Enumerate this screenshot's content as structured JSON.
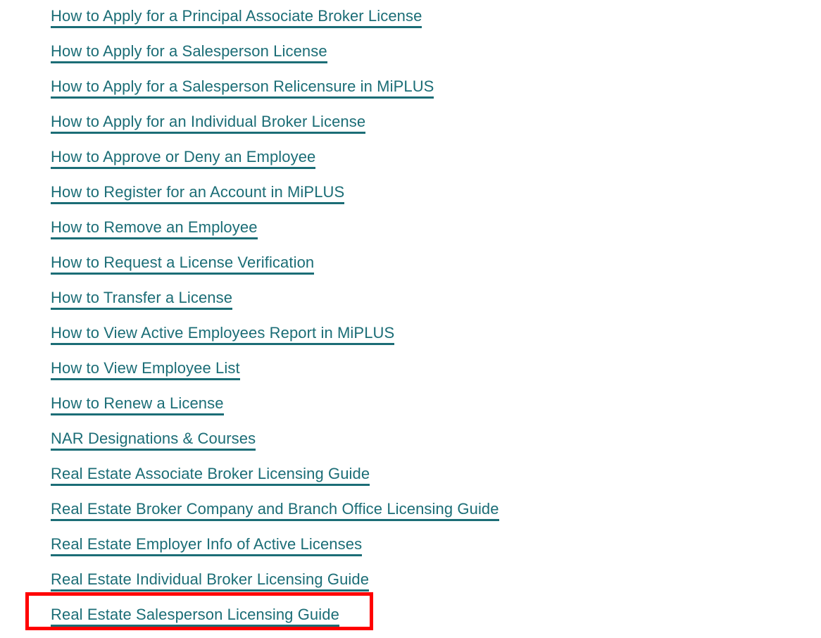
{
  "page": {
    "background_color": "#ffffff",
    "link_color": "#1b6d76",
    "highlight_color": "#ff0000"
  },
  "link_list": {
    "name": "real-estate-resources-link-list",
    "items": [
      {
        "label": "How to Apply for a Principal Associate Broker License"
      },
      {
        "label": "How to Apply for a Salesperson License"
      },
      {
        "label": "How to Apply for a Salesperson Relicensure in MiPLUS"
      },
      {
        "label": "How to Apply for an Individual Broker License"
      },
      {
        "label": "How to Approve or Deny an Employee"
      },
      {
        "label": "How to Register for an Account in MiPLUS"
      },
      {
        "label": "How to Remove an Employee"
      },
      {
        "label": "How to Request a License Verification"
      },
      {
        "label": "How to Transfer a License"
      },
      {
        "label": "How to View Active Employees Report in MiPLUS"
      },
      {
        "label": "How to View Employee List"
      },
      {
        "label": "How to Renew a License"
      },
      {
        "label": "NAR Designations & Courses"
      },
      {
        "label": "Real Estate Associate Broker Licensing Guide"
      },
      {
        "label": "Real Estate Broker Company and Branch Office Licensing Guide"
      },
      {
        "label": "Real Estate Employer Info of Active Licenses"
      },
      {
        "label": "Real Estate Individual Broker Licensing Guide"
      },
      {
        "label": "Real Estate Salesperson Licensing Guide"
      }
    ]
  },
  "highlight": {
    "target_label": "Real Estate Salesperson Licensing Guide"
  }
}
